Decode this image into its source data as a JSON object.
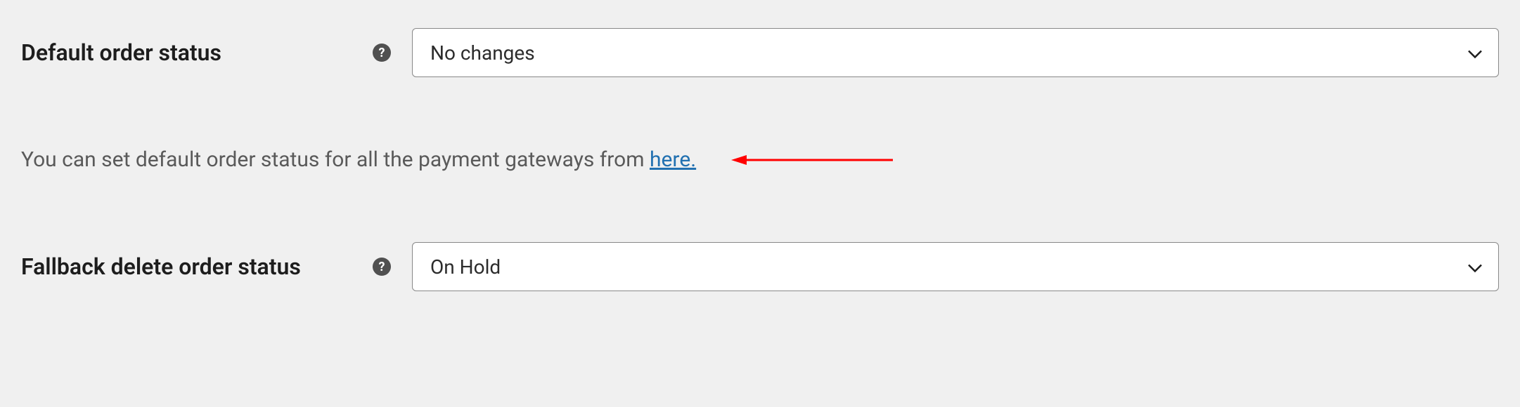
{
  "fields": {
    "default_order_status": {
      "label": "Default order status",
      "value": "No changes"
    },
    "fallback_delete_order_status": {
      "label": "Fallback delete order status",
      "value": "On Hold"
    }
  },
  "info": {
    "text_before": "You can set default order status for all the payment gateways from ",
    "link_text": "here."
  },
  "help_icon_char": "?"
}
